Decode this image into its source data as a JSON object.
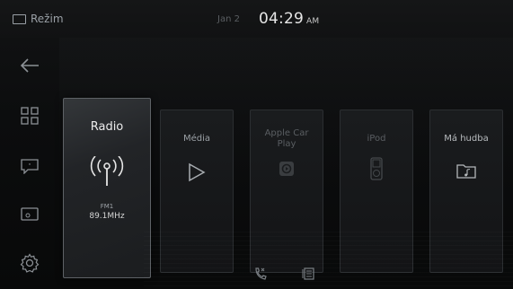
{
  "status_bar": {
    "mode_label": "Režim",
    "date": "Jan 2",
    "time": "04:29",
    "ampm": "AM"
  },
  "sidebar": {
    "items": [
      {
        "icon": "back-arrow-icon"
      },
      {
        "icon": "grid-menu-icon"
      },
      {
        "icon": "message-icon"
      },
      {
        "icon": "screen-icon"
      },
      {
        "icon": "settings-gear-icon"
      }
    ]
  },
  "sources": [
    {
      "label": "Radio",
      "icon": "radio-antenna-icon",
      "band": "FM1",
      "frequency": "89.1MHz",
      "selected": true
    },
    {
      "label": "Média",
      "icon": "play-icon"
    },
    {
      "label": "Apple Car Play",
      "label_line1": "Apple Car",
      "label_line2": "Play",
      "icon": "carplay-icon"
    },
    {
      "label": "iPod",
      "icon": "ipod-icon"
    },
    {
      "label": "Má hudba",
      "icon": "music-folder-icon"
    }
  ],
  "bottom_bar": {
    "icons": [
      "voice-call-icon",
      "menu-book-icon"
    ]
  },
  "colors": {
    "background": "#0a0b0c",
    "selected_border": "#5e6266",
    "card_border": "#2b2e31",
    "text_primary": "#ececec",
    "text_dim": "#5a5e62"
  }
}
